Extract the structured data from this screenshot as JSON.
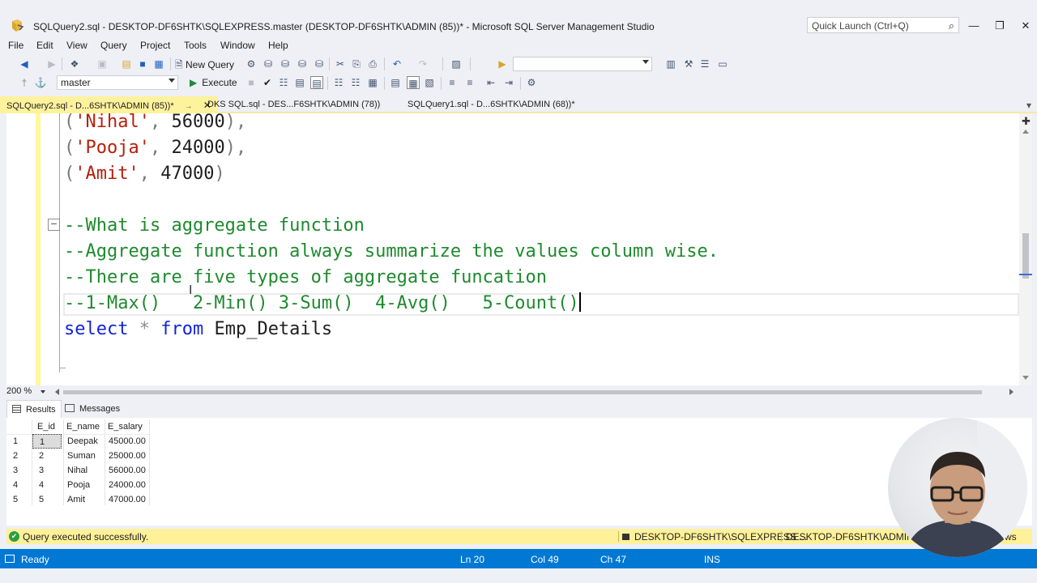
{
  "window": {
    "title": "SQLQuery2.sql - DESKTOP-DF6SHTK\\SQLEXPRESS.master (DESKTOP-DF6SHTK\\ADMIN (85))* - Microsoft SQL Server Management Studio",
    "quick_launch_placeholder": "Quick Launch (Ctrl+Q)"
  },
  "menu": [
    "File",
    "Edit",
    "View",
    "Query",
    "Project",
    "Tools",
    "Window",
    "Help"
  ],
  "toolbar": {
    "new_query_label": "New Query",
    "database": "master",
    "execute_label": "Execute"
  },
  "tabs": [
    {
      "label": "SQLQuery2.sql - D...6SHTK\\ADMIN (85))*",
      "active": true
    },
    {
      "label": "DKS SQL.sql - DES...F6SHTK\\ADMIN (78))",
      "active": false
    },
    {
      "label": "SQLQuery1.sql - D...6SHTK\\ADMIN (68))*",
      "active": false
    }
  ],
  "editor": {
    "lines": [
      {
        "tokens": [
          {
            "t": "(",
            "c": "punc"
          },
          {
            "t": "'Nihal'",
            "c": "str"
          },
          {
            "t": ", ",
            "c": "punc"
          },
          {
            "t": "56000",
            "c": "num"
          },
          {
            "t": "),",
            "c": "punc"
          }
        ]
      },
      {
        "tokens": [
          {
            "t": "(",
            "c": "punc"
          },
          {
            "t": "'Pooja'",
            "c": "str"
          },
          {
            "t": ", ",
            "c": "punc"
          },
          {
            "t": "24000",
            "c": "num"
          },
          {
            "t": "),",
            "c": "punc"
          }
        ]
      },
      {
        "tokens": [
          {
            "t": "(",
            "c": "punc"
          },
          {
            "t": "'Amit'",
            "c": "str"
          },
          {
            "t": ", ",
            "c": "punc"
          },
          {
            "t": "47000",
            "c": "num"
          },
          {
            "t": ")",
            "c": "punc"
          }
        ]
      },
      {
        "tokens": []
      },
      {
        "tokens": [
          {
            "t": "--What is aggregate function",
            "c": "cmt"
          }
        ]
      },
      {
        "tokens": [
          {
            "t": "--Aggregate function always summarize the values column wise.",
            "c": "cmt"
          }
        ]
      },
      {
        "tokens": [
          {
            "t": "--There are five types of aggregate funcation",
            "c": "cmt"
          }
        ]
      },
      {
        "tokens": [
          {
            "t": "--1-Max()   2-Min() 3-Sum()  4-Avg()   5-Count()",
            "c": "cmt"
          }
        ],
        "caret": true
      },
      {
        "tokens": [
          {
            "t": "select",
            "c": "kw"
          },
          {
            "t": " ",
            "c": "id"
          },
          {
            "t": "*",
            "c": "op"
          },
          {
            "t": " ",
            "c": "id"
          },
          {
            "t": "from",
            "c": "kw"
          },
          {
            "t": " Emp_Details",
            "c": "id"
          }
        ]
      }
    ]
  },
  "zoom": "200 %",
  "results": {
    "tabs": [
      "Results",
      "Messages"
    ],
    "columns": [
      "E_id",
      "E_name",
      "E_salary"
    ],
    "rows": [
      {
        "num": "1",
        "E_id": "1",
        "E_name": "Deepak",
        "E_salary": "45000.00"
      },
      {
        "num": "2",
        "E_id": "2",
        "E_name": "Suman",
        "E_salary": "25000.00"
      },
      {
        "num": "3",
        "E_id": "3",
        "E_name": "Nihal",
        "E_salary": "56000.00"
      },
      {
        "num": "4",
        "E_id": "4",
        "E_name": "Pooja",
        "E_salary": "24000.00"
      },
      {
        "num": "5",
        "E_id": "5",
        "E_name": "Amit",
        "E_salary": "47000.00"
      }
    ]
  },
  "query_status": {
    "message": "Query executed successfully.",
    "server": "DESKTOP-DF6SHTK\\SQLEXPRESS ...",
    "user": "DESKTOP-DF6SHTK\\ADMIN ...",
    "rows": "ws"
  },
  "statusbar": {
    "state": "Ready",
    "ln": "Ln 20",
    "col": "Col 49",
    "ch": "Ch 47",
    "mode": "INS"
  },
  "colors": {
    "statusbar": "#0078d4",
    "active_tab": "#fff29d",
    "query_status": "#fff199",
    "comment": "#1f8a2e",
    "keyword": "#1224d6",
    "string": "#b5200d"
  }
}
